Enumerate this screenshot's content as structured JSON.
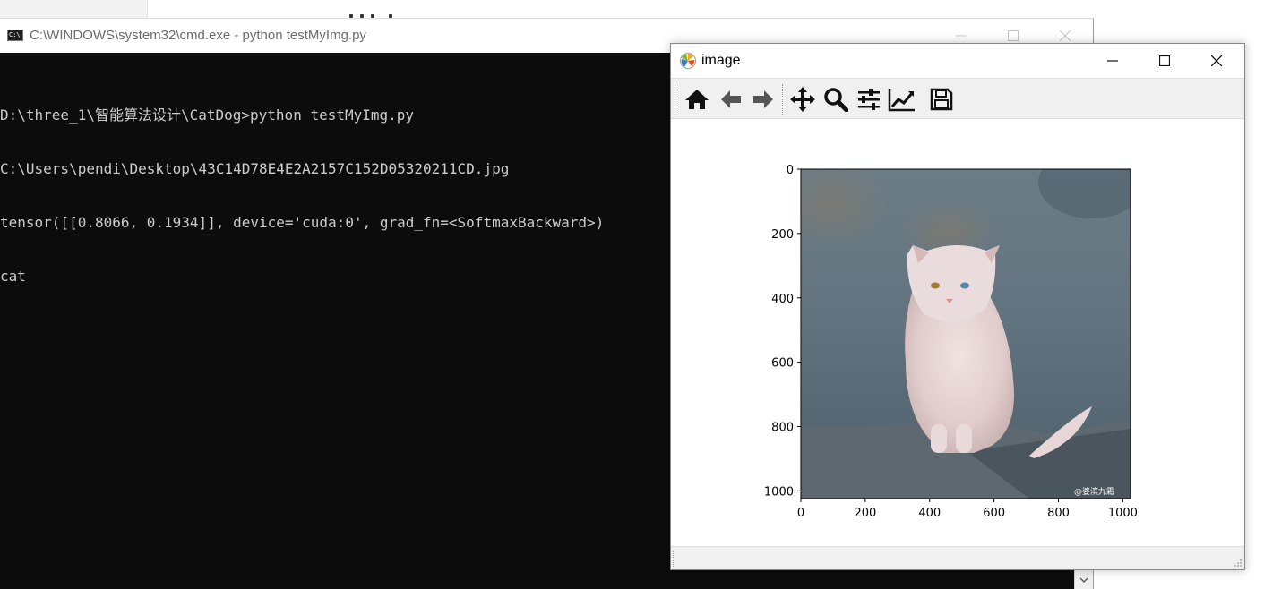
{
  "cmd_window": {
    "title": "C:\\WINDOWS\\system32\\cmd.exe - python  testMyImg.py",
    "lines": [
      "D:\\three_1\\智能算法设计\\CatDog>python testMyImg.py",
      "C:\\Users\\pendi\\Desktop\\43C14D78E4E2A2157C152D05320211CD.jpg",
      "tensor([[0.8066, 0.1934]], device='cuda:0', grad_fn=<SoftmaxBackward>)",
      "cat"
    ]
  },
  "image_window": {
    "title": "image",
    "toolbar": [
      {
        "name": "home",
        "icon": "home-icon"
      },
      {
        "name": "back",
        "icon": "arrow-left-icon"
      },
      {
        "name": "forward",
        "icon": "arrow-right-icon"
      },
      {
        "name": "pan",
        "icon": "move-icon"
      },
      {
        "name": "zoom",
        "icon": "search-icon"
      },
      {
        "name": "subplots",
        "icon": "sliders-icon"
      },
      {
        "name": "edit-axis",
        "icon": "chart-line-icon"
      },
      {
        "name": "save",
        "icon": "floppy-disk-icon"
      }
    ],
    "photo_watermark": "@婆滨九霜"
  },
  "chart_data": {
    "type": "image",
    "x_ticks": [
      "0",
      "200",
      "400",
      "600",
      "800",
      "1000"
    ],
    "y_ticks": [
      "0",
      "200",
      "400",
      "600",
      "800",
      "1000"
    ],
    "xlim": [
      0,
      1024
    ],
    "ylim": [
      1024,
      0
    ],
    "image_subject": "white fluffy cat sitting on a stone ledge"
  },
  "colors": {
    "console_bg": "#0c0c0c",
    "console_text": "#cccccc",
    "toolbar_bg": "#f0f0f0"
  }
}
